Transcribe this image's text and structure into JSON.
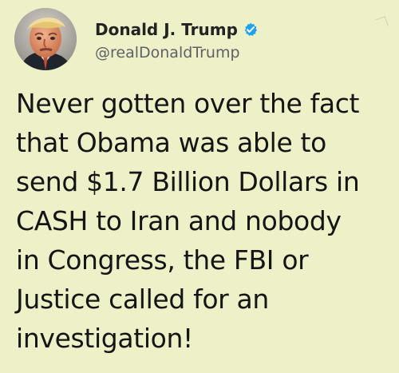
{
  "tweet": {
    "author": {
      "display_name": "Donald J. Trump",
      "handle": "@realDonaldTrump",
      "avatar_icon": "portrait-avatar",
      "verified_icon": "verified-badge-icon",
      "verified_color": "#1da1f2"
    },
    "text_lines": [
      "Never gotten over the fact",
      "that Obama was able to",
      "send $1.7 Billion Dollars in",
      "CASH to Iran and nobody",
      "in Congress, the FBI or",
      "Justice called for an",
      "investigation!"
    ]
  },
  "colors": {
    "background": "#eef0c8",
    "text": "#151515",
    "handle": "#5d6268"
  }
}
